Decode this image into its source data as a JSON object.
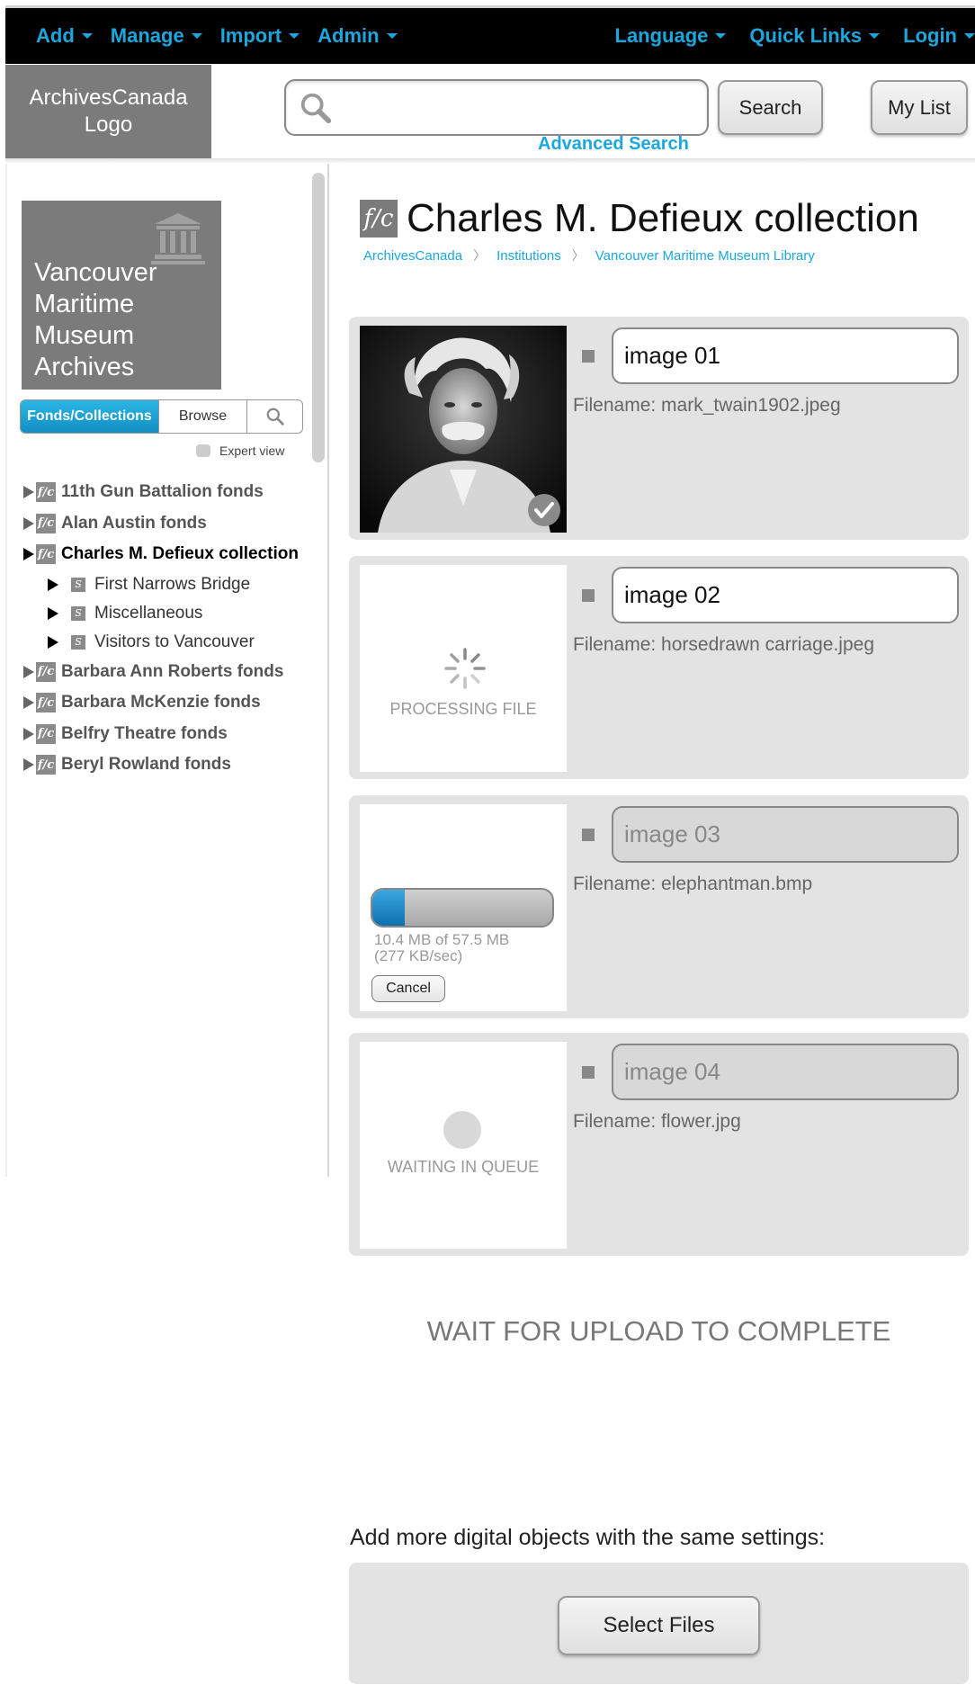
{
  "topnav": {
    "left": [
      "Add",
      "Manage",
      "Import",
      "Admin"
    ],
    "right": [
      "Language",
      "Quick Links",
      "Login"
    ]
  },
  "header": {
    "logo": "ArchivesCanada Logo",
    "search_button": "Search",
    "mylist_button": "My List",
    "advanced_search": "Advanced Search"
  },
  "sidebar": {
    "institution": "Vancouver Maritime Museum Archives",
    "tabs": {
      "fonds": "Fonds/Collections",
      "browse": "Browse"
    },
    "expert_view": "Expert view",
    "tree": [
      {
        "label": "11th Gun Battalion fonds",
        "level": 0,
        "badge": "f/c"
      },
      {
        "label": "Alan Austin fonds",
        "level": 0,
        "badge": "f/c"
      },
      {
        "label": "Charles M. Defieux collection",
        "level": 0,
        "badge": "f/c",
        "current": true
      },
      {
        "label": "First Narrows Bridge",
        "level": 1,
        "badge": "S"
      },
      {
        "label": "Miscellaneous",
        "level": 1,
        "badge": "S"
      },
      {
        "label": "Visitors to Vancouver",
        "level": 1,
        "badge": "S"
      },
      {
        "label": "Barbara Ann Roberts fonds",
        "level": 0,
        "badge": "f/c"
      },
      {
        "label": "Barbara McKenzie fonds",
        "level": 0,
        "badge": "f/c"
      },
      {
        "label": "Belfry Theatre fonds",
        "level": 0,
        "badge": "f/c"
      },
      {
        "label": "Beryl Rowland fonds",
        "level": 0,
        "badge": "f/c"
      }
    ]
  },
  "main": {
    "title_badge": "f/c",
    "title": "Charles M. Defieux collection",
    "breadcrumb": [
      "ArchivesCanada",
      "Institutions",
      "Vancouver Maritime Museum Library"
    ],
    "uploads": [
      {
        "name": "image 01",
        "filename": "Filename: mark_twain1902.jpeg",
        "status": "complete"
      },
      {
        "name": "image 02",
        "filename": "Filename: horsedrawn carriage.jpeg",
        "status": "processing",
        "status_label": "PROCESSING FILE"
      },
      {
        "name": "image 03",
        "filename": "Filename: elephantman.bmp",
        "status": "uploading",
        "progress_fraction": 0.18,
        "progress_text_1": "10.4 MB of 57.5 MB",
        "progress_text_2": "(277 KB/sec)",
        "cancel_label": "Cancel"
      },
      {
        "name": "image 04",
        "filename": "Filename: flower.jpg",
        "status": "queued",
        "status_label": "WAITING IN QUEUE"
      }
    ],
    "wait_message": "WAIT FOR UPLOAD TO COMPLETE",
    "add_more_label": "Add more digital objects with the same settings:",
    "select_files_label": "Select Files"
  },
  "colors": {
    "accent": "#1ba7dd",
    "panel": "#e3e3e3",
    "logo_bg": "#7b7b7b"
  }
}
